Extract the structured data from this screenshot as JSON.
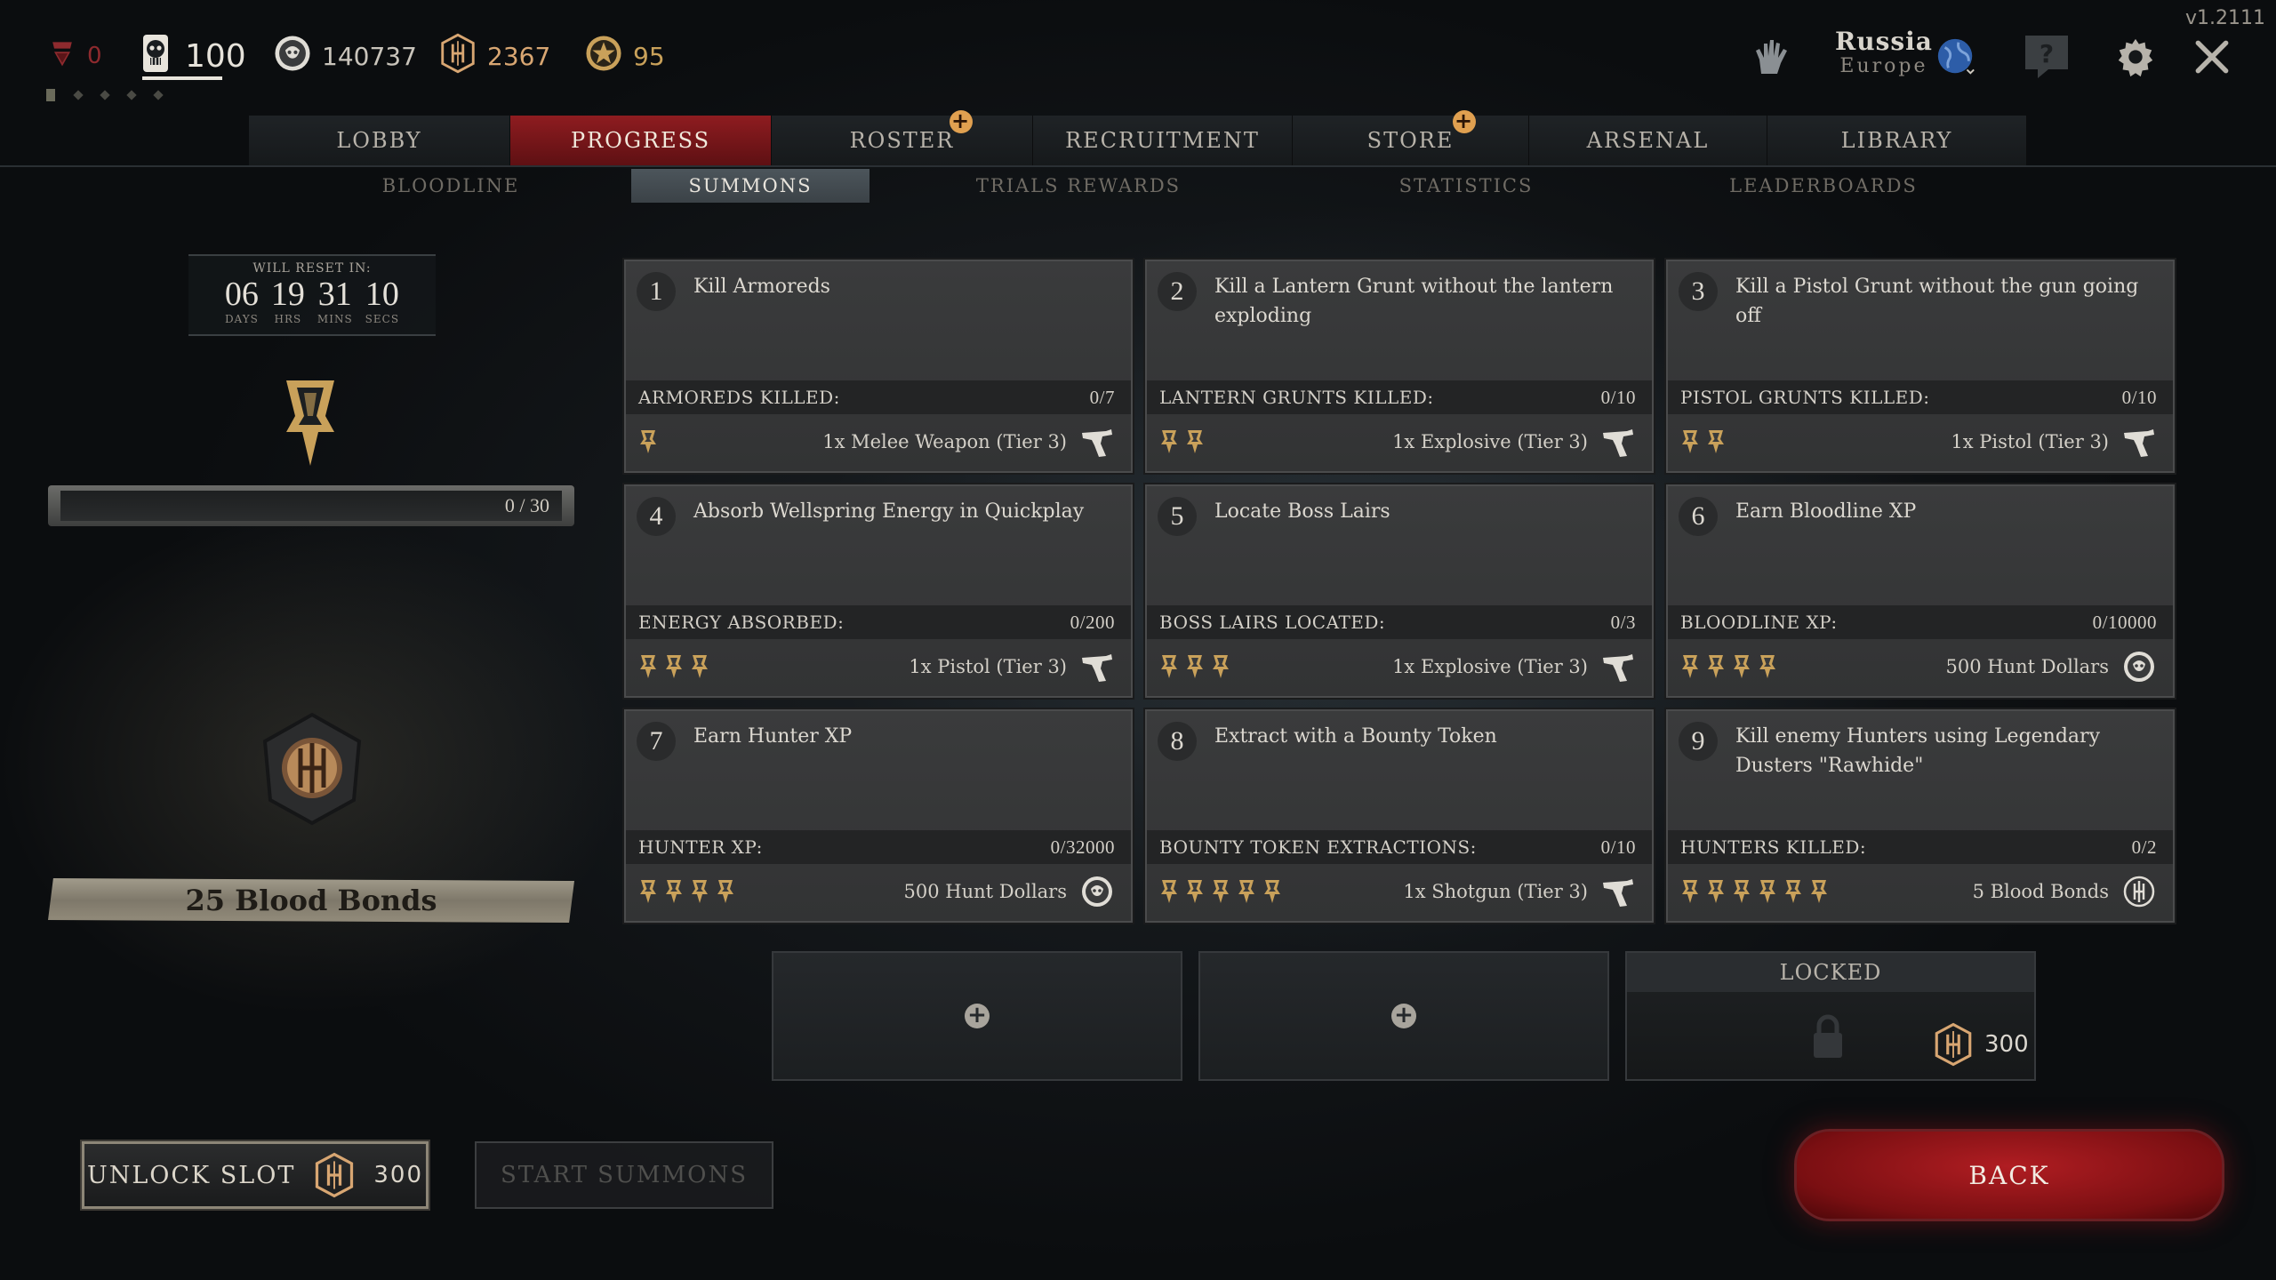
{
  "version": "v1.2111",
  "resources": {
    "rank_value": "0",
    "hunters": "100",
    "hunt_dollars": "140737",
    "blood_bonds": "2367",
    "event_points": "95"
  },
  "region": {
    "country": "Russia",
    "zone": "Europe"
  },
  "nav": {
    "tabs": [
      {
        "label": "LOBBY"
      },
      {
        "label": "PROGRESS"
      },
      {
        "label": "ROSTER"
      },
      {
        "label": "RECRUITMENT"
      },
      {
        "label": "STORE"
      },
      {
        "label": "ARSENAL"
      },
      {
        "label": "LIBRARY"
      }
    ],
    "subtabs": [
      {
        "label": "BLOODLINE"
      },
      {
        "label": "SUMMONS"
      },
      {
        "label": "TRIALS REWARDS"
      },
      {
        "label": "STATISTICS"
      },
      {
        "label": "LEADERBOARDS"
      }
    ],
    "active_tab": "PROGRESS",
    "active_subtab": "SUMMONS"
  },
  "timer": {
    "label": "WILL RESET IN:",
    "days": "06",
    "days_unit": "DAYS",
    "hrs": "19",
    "hrs_unit": "HRS",
    "mins": "31",
    "mins_unit": "MINS",
    "secs": "10",
    "secs_unit": "SECS"
  },
  "summons_progress": {
    "text": "0 / 30",
    "fraction": 0
  },
  "reward_label": "25 Blood Bonds",
  "cards": [
    {
      "num": "1",
      "title": "Kill Armoreds",
      "stat_label": "ARMOREDS KILLED:",
      "stat_value": "0/7",
      "medals": 1,
      "reward": "1x Melee Weapon (Tier 3)",
      "reward_icon": "gun-icon"
    },
    {
      "num": "2",
      "title": "Kill a Lantern Grunt without the lantern exploding",
      "stat_label": "LANTERN GRUNTS KILLED:",
      "stat_value": "0/10",
      "medals": 2,
      "reward": "1x Explosive (Tier 3)",
      "reward_icon": "gun-icon"
    },
    {
      "num": "3",
      "title": "Kill a Pistol Grunt without the gun going off",
      "stat_label": "PISTOL GRUNTS KILLED:",
      "stat_value": "0/10",
      "medals": 2,
      "reward": "1x Pistol (Tier 3)",
      "reward_icon": "gun-icon"
    },
    {
      "num": "4",
      "title": "Absorb Wellspring Energy in Quickplay",
      "stat_label": "ENERGY ABSORBED:",
      "stat_value": "0/200",
      "medals": 3,
      "reward": "1x Pistol (Tier 3)",
      "reward_icon": "gun-icon"
    },
    {
      "num": "5",
      "title": "Locate Boss Lairs",
      "stat_label": "BOSS LAIRS LOCATED:",
      "stat_value": "0/3",
      "medals": 3,
      "reward": "1x Explosive (Tier 3)",
      "reward_icon": "gun-icon"
    },
    {
      "num": "6",
      "title": "Earn Bloodline XP",
      "stat_label": "BLOODLINE XP:",
      "stat_value": "0/10000",
      "medals": 4,
      "reward": "500 Hunt Dollars",
      "reward_icon": "hunt-dollar-icon"
    },
    {
      "num": "7",
      "title": "Earn Hunter XP",
      "stat_label": "HUNTER XP:",
      "stat_value": "0/32000",
      "medals": 4,
      "reward": "500 Hunt Dollars",
      "reward_icon": "hunt-dollar-icon"
    },
    {
      "num": "8",
      "title": "Extract with a Bounty Token",
      "stat_label": "BOUNTY TOKEN EXTRACTIONS:",
      "stat_value": "0/10",
      "medals": 5,
      "reward": "1x Shotgun (Tier 3)",
      "reward_icon": "gun-icon"
    },
    {
      "num": "9",
      "title": "Kill enemy Hunters using Legendary Dusters \"Rawhide\"",
      "stat_label": "HUNTERS KILLED:",
      "stat_value": "0/2",
      "medals": 6,
      "reward": "5 Blood Bonds",
      "reward_icon": "blood-bond-icon"
    }
  ],
  "slots": {
    "locked_label": "LOCKED",
    "locked_cost": "300"
  },
  "buttons": {
    "unlock_slot": "UNLOCK SLOT",
    "unlock_cost": "300",
    "start_summons": "START SUMMONS",
    "back": "BACK"
  },
  "colors": {
    "accent_red": "#8e1c20",
    "gold": "#c9a15a",
    "card_bg": "#38393a"
  }
}
